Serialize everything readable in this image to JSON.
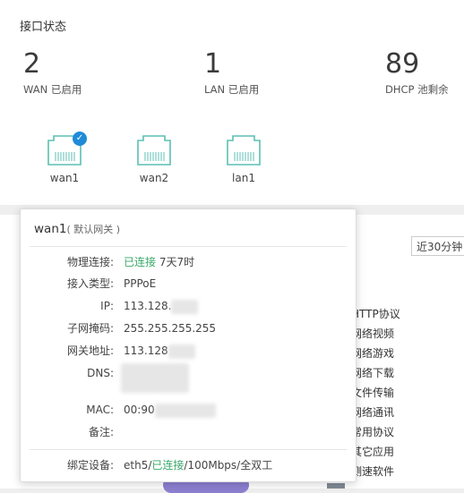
{
  "section_title": "接口状态",
  "stats": [
    {
      "value": "2",
      "label": "WAN 已启用"
    },
    {
      "value": "1",
      "label": "LAN 已启用"
    },
    {
      "value": "89",
      "label": "DHCP 池剩余"
    }
  ],
  "ports": [
    {
      "name": "wan1",
      "connected": true,
      "check": "✓"
    },
    {
      "name": "wan2",
      "connected": false
    },
    {
      "name": "lan1",
      "connected": false
    }
  ],
  "range_select": "近30分钟",
  "legend": [
    "HTTP协议",
    "网络视频",
    "网络游戏",
    "网络下载",
    "文件传输",
    "网络通讯",
    "常用协议",
    "其它应用",
    "测速软件"
  ],
  "popup": {
    "title": "wan1",
    "subtitle": "( 默认网关 )",
    "rows": {
      "physical_label": "物理连接:",
      "physical_status": "已连接",
      "physical_duration": "7天7时",
      "access_label": "接入类型:",
      "access_value": "PPPoE",
      "ip_label": "IP:",
      "ip_value": "113.128.",
      "mask_label": "子网掩码:",
      "mask_value": "255.255.255.255",
      "gateway_label": "网关地址:",
      "gateway_value": "113.128",
      "dns_label": "DNS:",
      "mac_label": "MAC:",
      "mac_value": "00:90",
      "note_label": "备注:",
      "bind_label": "绑定设备:",
      "bind_iface": "eth5/",
      "bind_status": "已连接",
      "bind_speed": "/100Mbps/全双工"
    }
  },
  "colors": {
    "accent": "#1f8bd8",
    "port": "#5cbfb4",
    "ok": "#3aa86a"
  }
}
